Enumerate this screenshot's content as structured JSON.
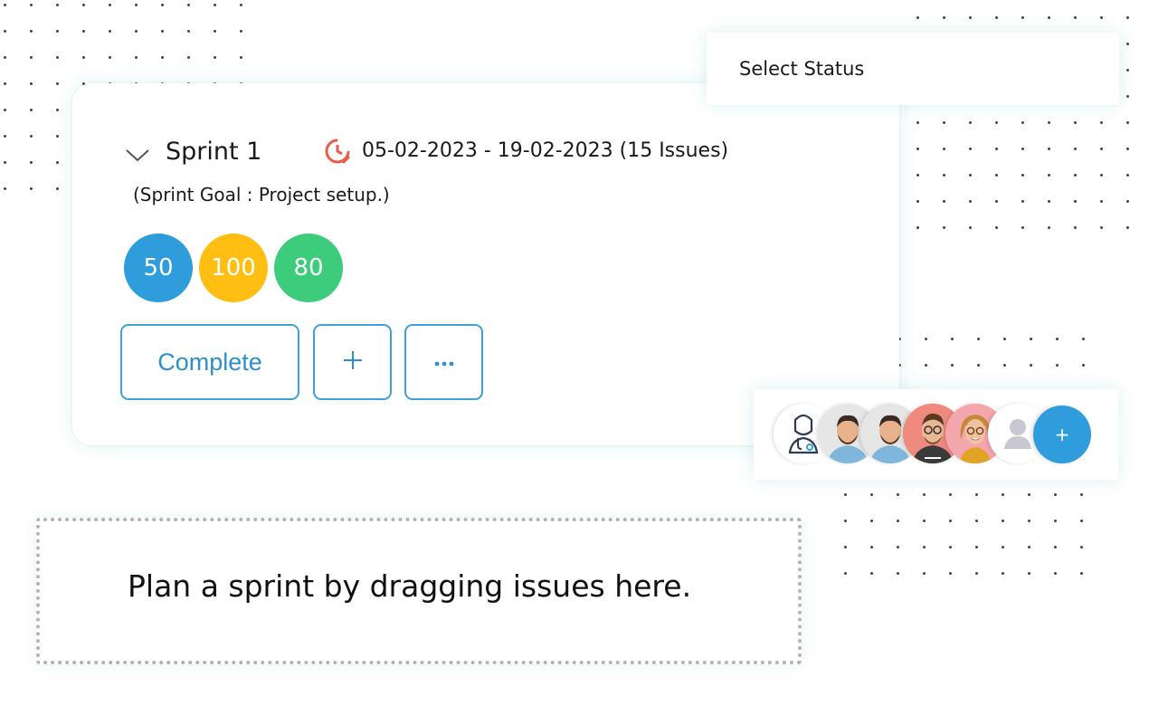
{
  "sprint": {
    "name": "Sprint 1",
    "date_range": "05-02-2023 - 19-02-2023 (15 Issues)",
    "goal": "(Sprint Goal : Project setup.)",
    "points": [
      {
        "value": "50",
        "color": "#2f9ddb"
      },
      {
        "value": "100",
        "color": "#ffbf12"
      },
      {
        "value": "80",
        "color": "#3ccc7c"
      }
    ],
    "actions": {
      "complete_label": "Complete",
      "add_label": "+",
      "more_label": "···"
    },
    "icons": {
      "collapse": "chevron-down-icon",
      "date": "clock-icon"
    }
  },
  "status_select": {
    "placeholder": "Select Status"
  },
  "team": {
    "members": [
      {
        "icon": "doctor-icon"
      },
      {
        "icon": "avatar-man-beard"
      },
      {
        "icon": "avatar-man-beard"
      },
      {
        "icon": "avatar-man-glasses"
      },
      {
        "icon": "avatar-woman-glasses"
      },
      {
        "icon": "user-placeholder-icon"
      }
    ],
    "add_label": "+"
  },
  "dropzone": {
    "message": "Plan a sprint by dragging issues here."
  },
  "colors": {
    "accent": "#2f9ddb",
    "clock": "#e85d4a",
    "border": "#3ea2d9"
  }
}
